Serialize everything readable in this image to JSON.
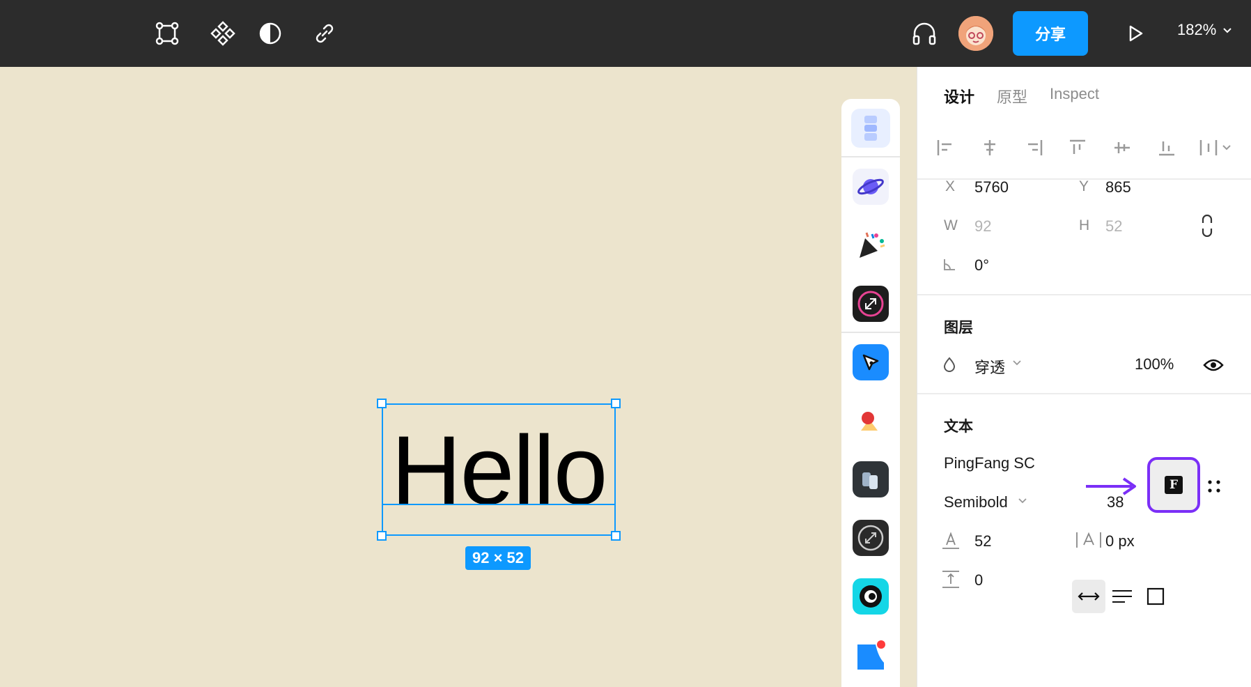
{
  "toolbar": {
    "share_label": "分享",
    "zoom_label": "182%",
    "icons": [
      "frame-tool-icon",
      "component-icon",
      "contrast-icon",
      "link-icon",
      "headphones-icon",
      "play-icon"
    ]
  },
  "canvas": {
    "text_content": "Hello",
    "size_badge": "92 × 52",
    "background": "#ece4cd",
    "selection_color": "#0d99ff"
  },
  "dock": {
    "items": [
      "layout-plugin",
      "planet-plugin",
      "party-plugin",
      "resize-plugin",
      "pen-plugin",
      "shapes-plugin",
      "mirror-plugin",
      "scale-plugin",
      "eye-plugin",
      "corner-plugin"
    ]
  },
  "panel": {
    "tabs": [
      "设计",
      "原型",
      "Inspect"
    ],
    "position": {
      "x_label": "X",
      "x_value": "5760",
      "y_label": "Y",
      "y_value": "865",
      "w_label": "W",
      "w_value": "92",
      "h_label": "H",
      "h_value": "52",
      "rotation_value": "0°"
    },
    "layer": {
      "title": "图层",
      "blend_mode": "穿透",
      "opacity": "100%"
    },
    "text": {
      "title": "文本",
      "font_family": "PingFang SC",
      "font_weight": "Semibold",
      "font_size": "38",
      "line_height": "52",
      "letter_spacing": "0 px",
      "paragraph_spacing": "0"
    },
    "accent_color": "#7b2ff7"
  }
}
